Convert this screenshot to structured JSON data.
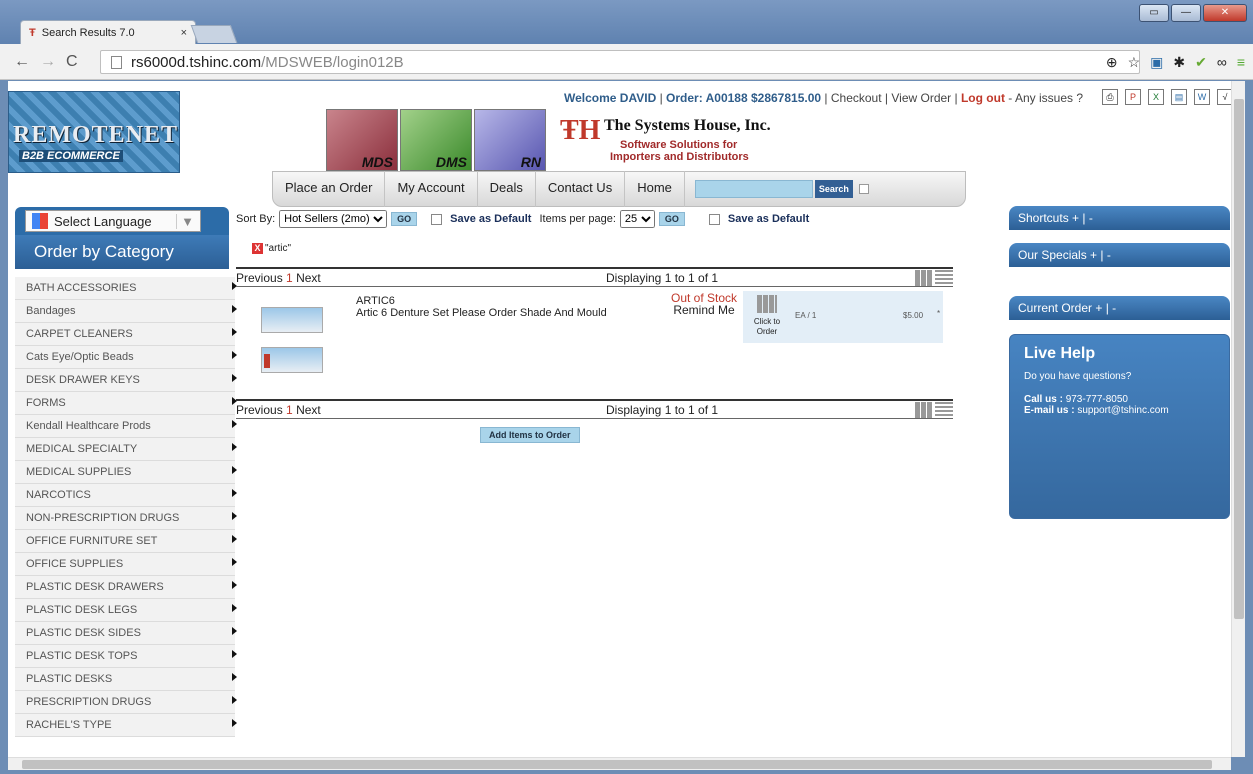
{
  "browser": {
    "tab_title": "Search Results 7.0",
    "tab_close": "×",
    "url_host": "rs6000d.tshinc.com",
    "url_path": "/MDSWEB/login012B",
    "window_buttons": [
      "▭",
      "—",
      "✕"
    ]
  },
  "header": {
    "logo_main": "REMOTENET",
    "logo_sub": "B2B ECOMMERCE",
    "products": [
      "MDS",
      "DMS",
      "RN"
    ],
    "company_name": "The Systems House, Inc.",
    "company_tag1": "Software Solutions for",
    "company_tag2": "Importers and Distributors",
    "company_mark": "ŦH",
    "welcome": "Welcome DAVID",
    "order": "Order: A00188 $2867815.00",
    "checkout": "Checkout",
    "view_order": "View Order",
    "logout": "Log out",
    "issues": "- Any issues ?"
  },
  "nav": {
    "items": [
      "Place an Order",
      "My Account",
      "Deals",
      "Contact Us",
      "Home"
    ],
    "search_button": "Search"
  },
  "sidebar": {
    "language": "Select Language",
    "heading": "Order by Category",
    "categories": [
      "BATH ACCESSORIES",
      "Bandages",
      "CARPET CLEANERS",
      "Cats Eye/Optic Beads",
      "DESK DRAWER KEYS",
      "FORMS",
      "Kendall Healthcare Prods",
      "MEDICAL SPECIALTY",
      "MEDICAL SUPPLIES",
      "NARCOTICS",
      "NON-PRESCRIPTION DRUGS",
      "OFFICE FURNITURE SET",
      "OFFICE SUPPLIES",
      "PLASTIC DESK DRAWERS",
      "PLASTIC DESK LEGS",
      "PLASTIC DESK SIDES",
      "PLASTIC DESK TOPS",
      "PLASTIC DESKS",
      "PRESCRIPTION DRUGS",
      "RACHEL'S TYPE"
    ]
  },
  "sort": {
    "label": "Sort By:",
    "value": "Hot Sellers (2mo)",
    "go": "GO",
    "save_default": "Save as Default",
    "per_page_label": "Items per page:",
    "per_page": "25"
  },
  "filter": {
    "x": "X",
    "term": "\"artic\""
  },
  "pager": {
    "previous": "Previous",
    "page": "1",
    "next": "Next",
    "displaying": "Displaying 1 to 1 of 1"
  },
  "item": {
    "sku": "ARTIC6",
    "description": "Artic 6 Denture Set Please Order Shade And Mould",
    "stock": "Out of Stock",
    "remind": "Remind Me",
    "click_to_order": "Click to Order",
    "unit": "EA / 1",
    "price": "$5.00",
    "star": "*"
  },
  "add_items": "Add Items to Order",
  "right_panels": [
    "Shortcuts + | -",
    "Our Specials + | -",
    "Current Order + | -"
  ],
  "live_help": {
    "title": "Live Help",
    "question": "Do you have questions?",
    "call_label": "Call us :",
    "phone": "973-777-8050",
    "email_label": "E-mail us :",
    "email": "support@tshinc.com"
  }
}
